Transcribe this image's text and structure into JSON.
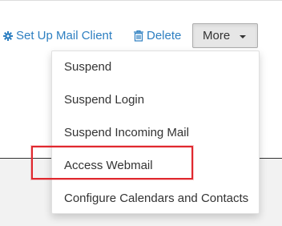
{
  "actions": {
    "setup_mail_client": "Set Up Mail Client",
    "delete": "Delete",
    "more": "More"
  },
  "menu": {
    "items": [
      {
        "label": "Suspend"
      },
      {
        "label": "Suspend Login"
      },
      {
        "label": "Suspend Incoming Mail"
      },
      {
        "label": "Access Webmail",
        "highlighted": true
      },
      {
        "label": "Configure Calendars and Contacts"
      }
    ]
  },
  "colors": {
    "link": "#2d7fc1",
    "highlight": "#e0282e",
    "button_bg": "#e6e6e6",
    "text": "#333333"
  },
  "icons": {
    "setup": "gear-icon",
    "delete": "trash-icon",
    "more": "caret-down-icon"
  }
}
